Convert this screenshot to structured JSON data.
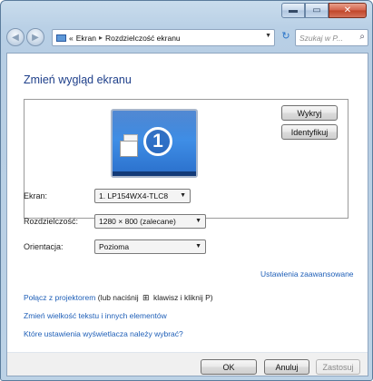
{
  "window": {
    "caption": {
      "minimize_icon": "minimize-icon",
      "maximize_icon": "maximize-icon",
      "close_icon": "close-icon"
    }
  },
  "nav": {
    "back_icon": "back-arrow-icon",
    "forward_icon": "forward-arrow-icon",
    "address_prefix": "«",
    "breadcrumb": [
      "Ekran",
      "Rozdzielczość ekranu"
    ],
    "separator": "▸",
    "search_placeholder": "Szukaj w P...",
    "search_icon": "search-icon",
    "refresh_icon": "refresh-icon"
  },
  "main": {
    "title": "Zmień wygląd ekranu",
    "monitor_number": "1",
    "detect_label": "Wykryj",
    "identify_label": "Identyfikuj",
    "fields": {
      "screen_label": "Ekran:",
      "screen_value": "1. LP154WX4-TLC8",
      "resolution_label": "Rozdzielczość:",
      "resolution_value": "1280 × 800 (zalecane)",
      "orientation_label": "Orientacja:",
      "orientation_value": "Pozioma"
    },
    "advanced_link": "Ustawienia zaawansowane",
    "links": {
      "projector_link": "Połącz z projektorem",
      "projector_rest_1": "(lub naciśnij",
      "projector_rest_2": "klawisz i kliknij P)",
      "text_size_link": "Zmień wielkość tekstu i innych elementów",
      "which_settings_link": "Które ustawienia wyświetlacza należy wybrać?"
    }
  },
  "footer": {
    "ok": "OK",
    "cancel": "Anuluj",
    "apply": "Zastosuj"
  },
  "colors": {
    "title_blue": "#1e3f8a",
    "link_blue": "#2060b8",
    "monitor_blue": "#2a6fcb",
    "close_red": "#c04428"
  }
}
